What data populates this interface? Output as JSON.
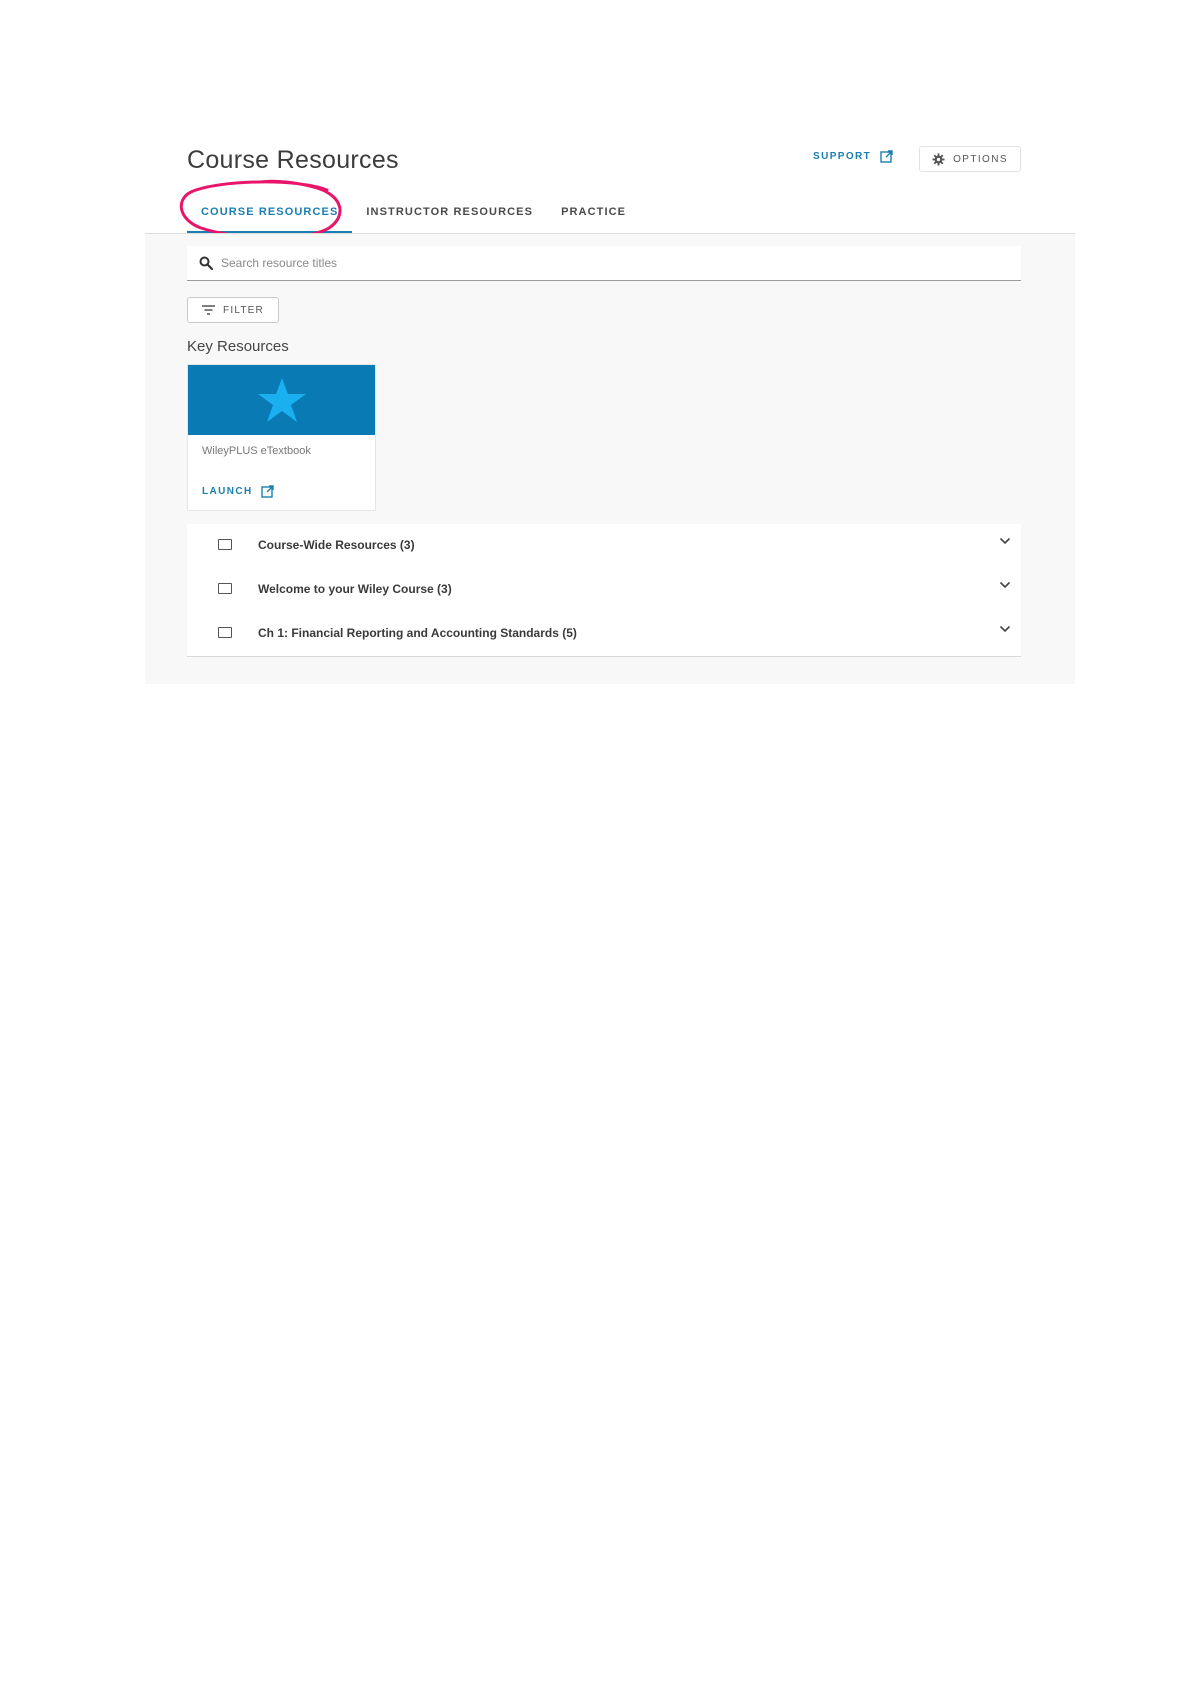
{
  "header": {
    "title": "Course Resources",
    "support_label": "SUPPORT",
    "options_label": "OPTIONS"
  },
  "tabs": [
    {
      "label": "COURSE RESOURCES",
      "active": true
    },
    {
      "label": "INSTRUCTOR RESOURCES",
      "active": false
    },
    {
      "label": "PRACTICE",
      "active": false
    }
  ],
  "search": {
    "placeholder": "Search resource titles",
    "value": ""
  },
  "filter": {
    "label": "FILTER"
  },
  "key_resources": {
    "heading": "Key Resources",
    "cards": [
      {
        "title": "WileyPLUS eTextbook",
        "action_label": "LAUNCH",
        "icon": "star-icon"
      }
    ]
  },
  "resource_list": [
    {
      "label": "Course-Wide Resources (3)"
    },
    {
      "label": "Welcome to your Wiley Course (3)"
    },
    {
      "label": "Ch 1: Financial Reporting and Accounting Standards (5)"
    }
  ],
  "colors": {
    "accent": "#1a7fb0",
    "card_banner": "#0a7ab5",
    "star": "#1ab0f0",
    "annotation": "#e8156b"
  }
}
